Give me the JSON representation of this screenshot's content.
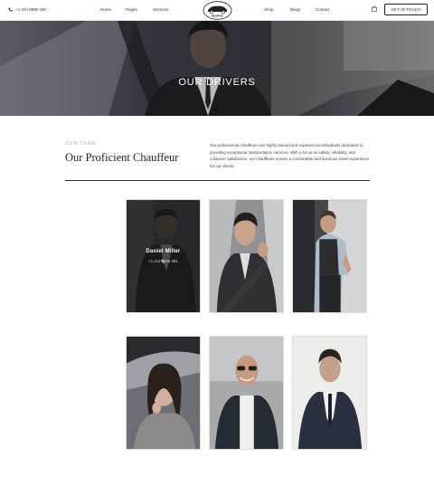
{
  "header": {
    "phone": "+1 324 8596 330",
    "nav": [
      "Home",
      "Pages",
      "Services",
      "Shop",
      "Blogs",
      "Contact"
    ],
    "logo_text": "MODRIVE",
    "cta_label": "GET IN TOUCH"
  },
  "hero": {
    "title": "OUR DRIVERS"
  },
  "section": {
    "eyebrow": "OUR TEAM",
    "title": "Our Proficient Chauffeur",
    "intro": "Our professional chauffeurs are highly trained and experienced individuals dedicated to providing exceptional transportation services. With a focus on safety, reliability, and customer satisfaction, our chauffeurs ensure a comfortable and luxurious travel experience for our clients."
  },
  "drivers": [
    {
      "name": "Daniel Miller",
      "phone": "+1 213 5785 281",
      "highlighted": true
    },
    {
      "name": "",
      "phone": ""
    },
    {
      "name": "",
      "phone": ""
    },
    {
      "name": "",
      "phone": ""
    },
    {
      "name": "",
      "phone": ""
    },
    {
      "name": "",
      "phone": ""
    }
  ],
  "colors": {
    "accent": "#c9a58c",
    "dark": "#222222"
  }
}
